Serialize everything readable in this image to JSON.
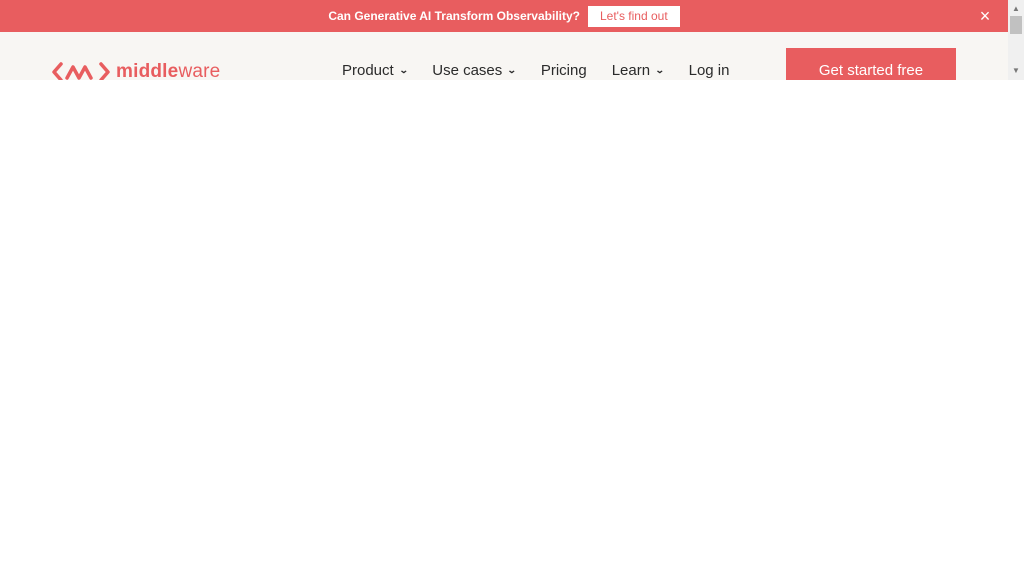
{
  "announcement": {
    "text": "Can Generative AI Transform Observability?",
    "button_label": "Let's find out",
    "close_icon": "×"
  },
  "brand": {
    "name_bold": "middle",
    "name_rest": "ware",
    "icon": "middleware-logo-icon",
    "color": "#e85d5f"
  },
  "nav": {
    "items": [
      {
        "label": "Product",
        "dropdown": true,
        "chevron": "⌄"
      },
      {
        "label": "Use cases",
        "dropdown": true,
        "chevron": "⌄"
      },
      {
        "label": "Pricing",
        "dropdown": false
      },
      {
        "label": "Learn",
        "dropdown": true,
        "chevron": "⌄"
      },
      {
        "label": "Log in",
        "dropdown": false
      }
    ],
    "cta_label": "Get started free"
  },
  "scrollbar": {
    "up": "▲",
    "down": "▼"
  }
}
